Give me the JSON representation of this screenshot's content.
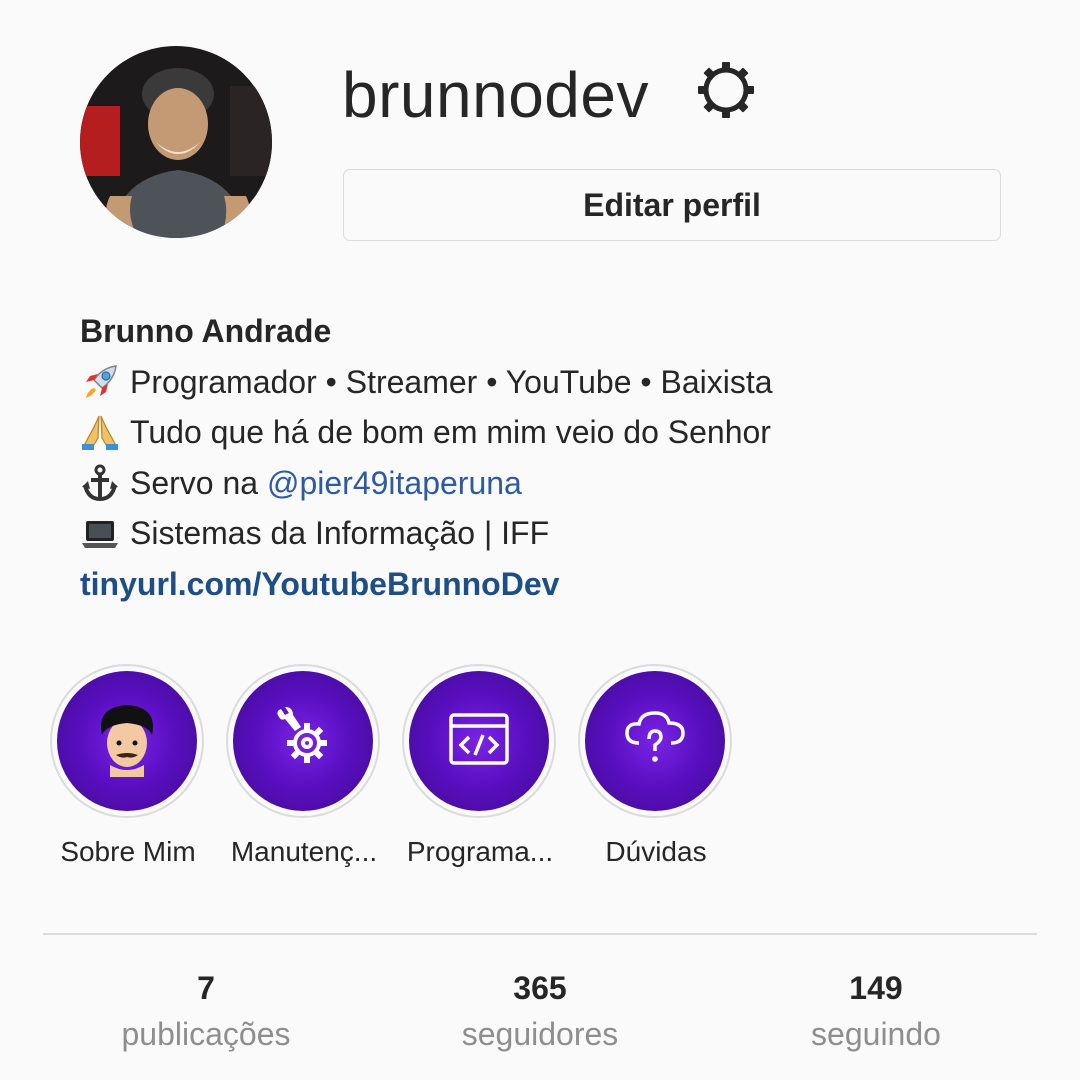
{
  "profile": {
    "username": "brunnodev",
    "edit_label": "Editar perfil",
    "full_name": "Brunno Andrade",
    "bio_lines": [
      {
        "icon": "rocket-icon",
        "text": "Programador • Streamer • YouTube • Baixista"
      },
      {
        "icon": "praying-hands-icon",
        "text": "Tudo que há de bom em mim veio do Senhor"
      },
      {
        "icon": "anchor-icon",
        "prefix": "Servo na ",
        "mention": "@pier49itaperuna"
      },
      {
        "icon": "laptop-icon",
        "text": "Sistemas da Informação | IFF"
      }
    ],
    "website": "tinyurl.com/YoutubeBrunnoDev"
  },
  "highlights": [
    {
      "label": "Sobre Mim",
      "icon": "avatar-face-icon"
    },
    {
      "label": "Manutenç...",
      "icon": "wrench-gear-icon"
    },
    {
      "label": "Programa...",
      "icon": "code-window-icon"
    },
    {
      "label": "Dúvidas",
      "icon": "cloud-question-icon"
    }
  ],
  "stats": [
    {
      "value": "7",
      "label": "publicações"
    },
    {
      "value": "365",
      "label": "seguidores"
    },
    {
      "value": "149",
      "label": "seguindo"
    }
  ],
  "colors": {
    "highlight_purple": "#5a0fc2",
    "link_blue": "#1d4f86",
    "muted_gray": "#8e8e8e"
  }
}
